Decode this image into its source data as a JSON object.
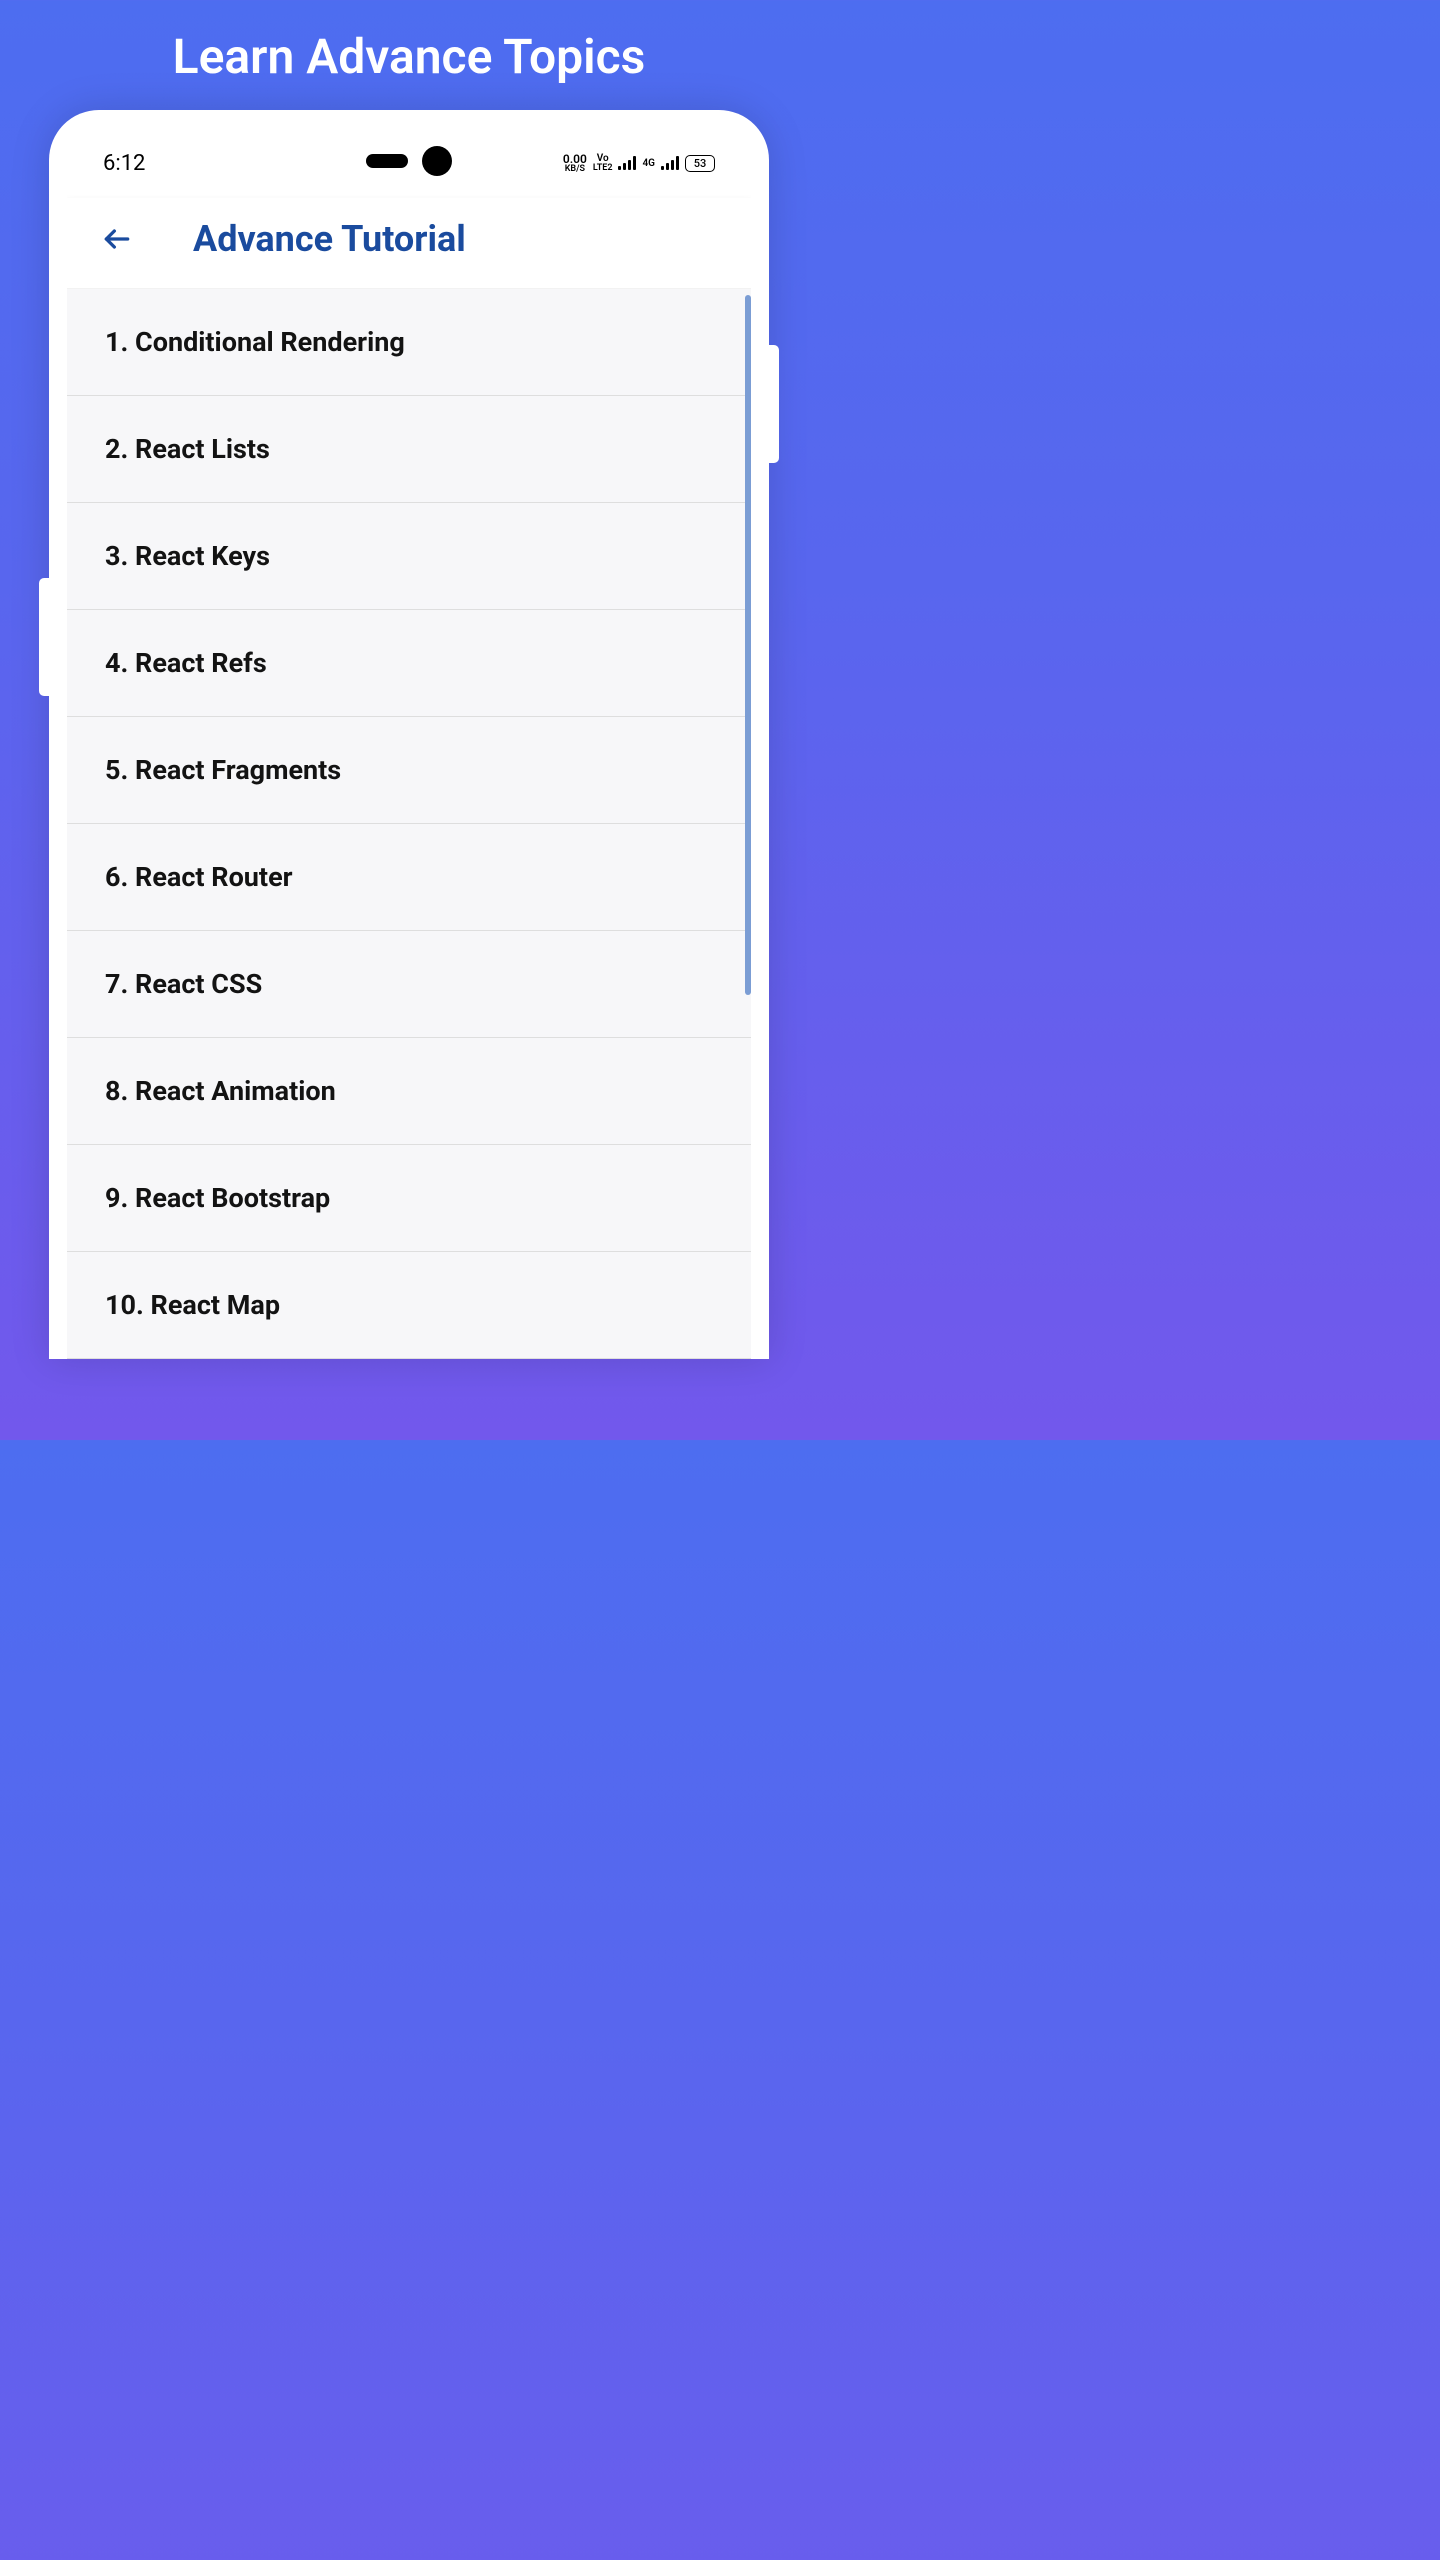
{
  "promo": {
    "title": "Learn Advance Topics"
  },
  "status_bar": {
    "time": "6:12",
    "data_rate_top": "0.00",
    "data_rate_bottom": "KB/S",
    "volte_top": "Vo",
    "volte_bottom": "LTE2",
    "network_type": "4G",
    "battery": "53"
  },
  "header": {
    "title": "Advance Tutorial"
  },
  "topics": [
    {
      "label": "1. Conditional Rendering"
    },
    {
      "label": "2. React Lists"
    },
    {
      "label": "3. React Keys"
    },
    {
      "label": "4. React Refs"
    },
    {
      "label": "5. React Fragments"
    },
    {
      "label": "6. React Router"
    },
    {
      "label": "7. React CSS"
    },
    {
      "label": "8. React Animation"
    },
    {
      "label": "9. React Bootstrap"
    },
    {
      "label": "10. React Map"
    }
  ]
}
